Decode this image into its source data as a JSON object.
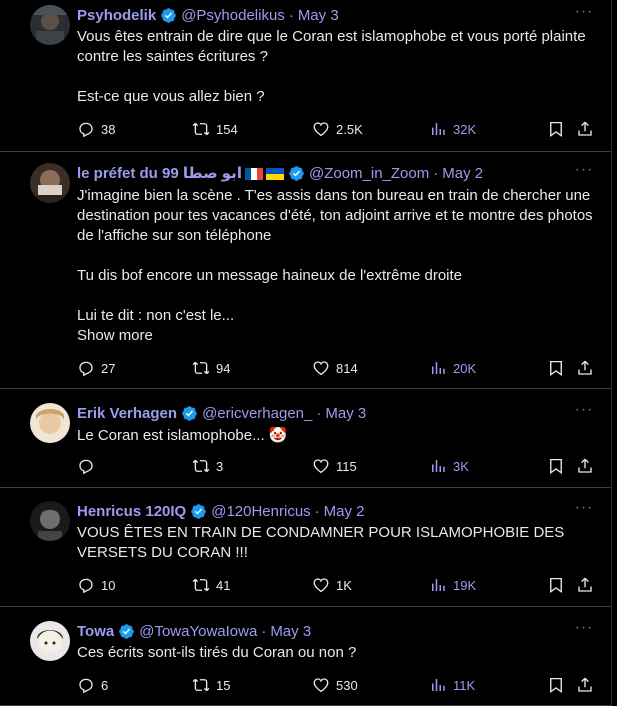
{
  "tweets": [
    {
      "name": "Psyhodelik",
      "handle": "@Psyhodelikus",
      "time": "May 3",
      "text": "Vous êtes entrain de dire que le Coran est islamophobe et vous porté plainte contre les saintes écritures ?\n\nEst-ce que vous allez bien ?",
      "show_more": "",
      "replies": "38",
      "retweets": "154",
      "likes": "2.5K",
      "views": "32K",
      "avatar_color": "#3a3f44"
    },
    {
      "name": "le préfet du 99 ابو صطا",
      "handle": "@Zoom_in_Zoom",
      "time": "May 2",
      "text": "J'imagine bien la scène . T'es assis dans ton bureau en train de chercher une destination pour tes vacances d'été, ton adjoint arrive et te montre des photos de l'affiche sur son téléphone\n\nTu dis bof encore un message haineux de l'extrême droite\n\nLui te dit : non c'est le...",
      "show_more": "Show more",
      "replies": "27",
      "retweets": "94",
      "likes": "814",
      "views": "20K",
      "avatar_color": "#5a4a40"
    },
    {
      "name": "Erik Verhagen",
      "handle": "@ericverhagen_",
      "time": "May 3",
      "text": "Le Coran est islamophobe... 🤡",
      "show_more": "",
      "replies": "",
      "retweets": "3",
      "likes": "115",
      "views": "3K",
      "avatar_color": "#d9b98a"
    },
    {
      "name": "Henricus 120IQ",
      "handle": "@120Henricus",
      "time": "May 2",
      "text": "VOUS ÊTES EN TRAIN DE CONDAMNER POUR ISLAMOPHOBIE DES VERSETS DU CORAN !!!",
      "show_more": "",
      "replies": "10",
      "retweets": "41",
      "likes": "1K",
      "views": "19K",
      "avatar_color": "#2b2b2b"
    },
    {
      "name": "Towa",
      "handle": "@TowaYowaIowa",
      "time": "May 3",
      "text": "Ces écrits sont-ils tirés du Coran ou non ?",
      "show_more": "",
      "replies": "6",
      "retweets": "15",
      "likes": "530",
      "views": "11K",
      "avatar_color": "#d8d8d8"
    }
  ],
  "colors": {
    "accent": "#9b9bf0",
    "verified": "#1d9bf0",
    "background": "#000000",
    "text": "#e7e9ea",
    "divider": "#2f3336"
  },
  "icons": {
    "reply": "reply-icon",
    "retweet": "retweet-icon",
    "like": "heart-icon",
    "views": "views-icon",
    "bookmark": "bookmark-icon",
    "share": "share-icon",
    "more": "more-options-icon",
    "verified": "verified-badge-icon"
  }
}
